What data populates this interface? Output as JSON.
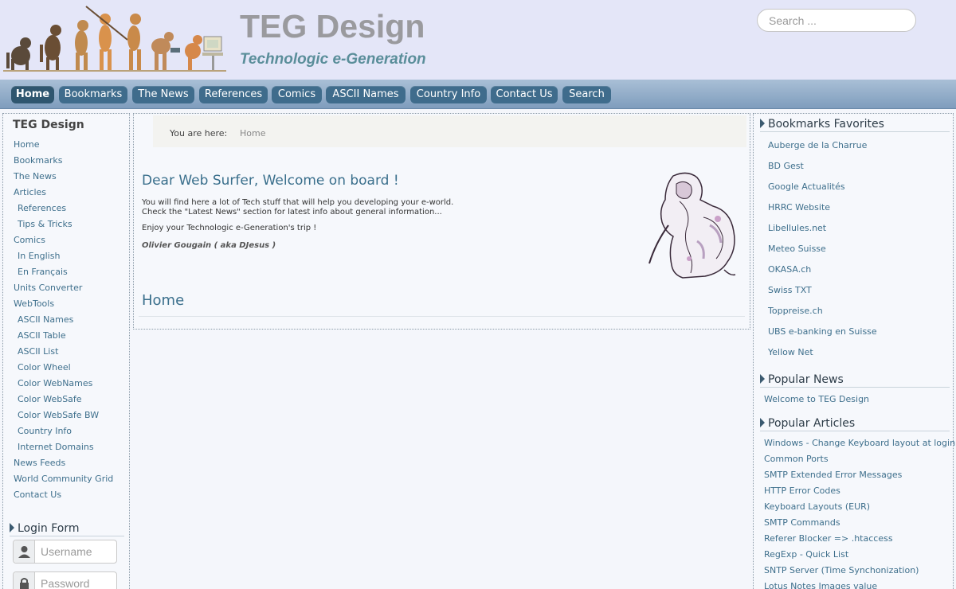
{
  "header": {
    "title": "TEG Design",
    "slogan": "Technologic e-Generation",
    "search_placeholder": "Search ..."
  },
  "nav": [
    {
      "label": "Home"
    },
    {
      "label": "Bookmarks"
    },
    {
      "label": "The News"
    },
    {
      "label": "References"
    },
    {
      "label": "Comics"
    },
    {
      "label": "ASCII Names"
    },
    {
      "label": "Country Info"
    },
    {
      "label": "Contact Us"
    },
    {
      "label": "Search"
    }
  ],
  "left_menu": {
    "title": "TEG Design",
    "items": [
      {
        "label": "Home"
      },
      {
        "label": "Bookmarks"
      },
      {
        "label": "The News"
      },
      {
        "label": "Articles"
      },
      {
        "label": "References"
      },
      {
        "label": "Tips & Tricks"
      },
      {
        "label": "Comics"
      },
      {
        "label": "In English"
      },
      {
        "label": "En Français"
      },
      {
        "label": "Units Converter"
      },
      {
        "label": "WebTools"
      },
      {
        "label": "ASCII Names"
      },
      {
        "label": "ASCII Table"
      },
      {
        "label": "ASCII List"
      },
      {
        "label": "Color Wheel"
      },
      {
        "label": "Color WebNames"
      },
      {
        "label": "Color WebSafe"
      },
      {
        "label": "Color WebSafe BW"
      },
      {
        "label": "Country Info"
      },
      {
        "label": "Internet Domains"
      },
      {
        "label": "News Feeds"
      },
      {
        "label": "World Community Grid"
      },
      {
        "label": "Contact Us"
      }
    ]
  },
  "login": {
    "title": "Login Form",
    "username_placeholder": "Username",
    "password_placeholder": "Password"
  },
  "breadcrumb": {
    "label": "You are here:",
    "current": "Home"
  },
  "main": {
    "welcome_title": "Dear Web Surfer, Welcome on board !",
    "intro_line1": "You will find here a lot of Tech stuff that will help you developing your e-world.",
    "intro_line2": "Check the \"Latest News\" section for latest info about general information...",
    "enjoy": "Enjoy your Technologic e-Generation's trip !",
    "signature": "Olivier Gougain ( aka DJesus )",
    "home_heading": "Home"
  },
  "bookmarks": {
    "title": "Bookmarks Favorites",
    "items": [
      {
        "label": "Auberge de la Charrue"
      },
      {
        "label": "BD Gest"
      },
      {
        "label": "Google Actualités"
      },
      {
        "label": "HRRC Website"
      },
      {
        "label": "Libellules.net"
      },
      {
        "label": "Meteo Suisse"
      },
      {
        "label": "OKASA.ch"
      },
      {
        "label": "Swiss TXT"
      },
      {
        "label": "Toppreise.ch"
      },
      {
        "label": "UBS e-banking en Suisse"
      },
      {
        "label": "Yellow Net"
      }
    ]
  },
  "popular_news": {
    "title": "Popular News",
    "items": [
      {
        "label": "Welcome to TEG Design"
      }
    ]
  },
  "popular_articles": {
    "title": "Popular Articles",
    "items": [
      {
        "label": "Windows - Change Keyboard layout at login"
      },
      {
        "label": "Common Ports"
      },
      {
        "label": "SMTP Extended Error Messages"
      },
      {
        "label": "HTTP Error Codes"
      },
      {
        "label": "Keyboard Layouts (EUR)"
      },
      {
        "label": "SMTP Commands"
      },
      {
        "label": "Referer Blocker => .htaccess"
      },
      {
        "label": "RegExp - Quick List"
      },
      {
        "label": "SNTP Server (Time Synchonization)"
      },
      {
        "label": "Lotus Notes Images value"
      }
    ]
  },
  "colors": {
    "header_bg": "#e4e6f8",
    "nav_button": "#3f6c8c",
    "link": "#3e6f8c",
    "slogan": "#5a8e9a"
  }
}
